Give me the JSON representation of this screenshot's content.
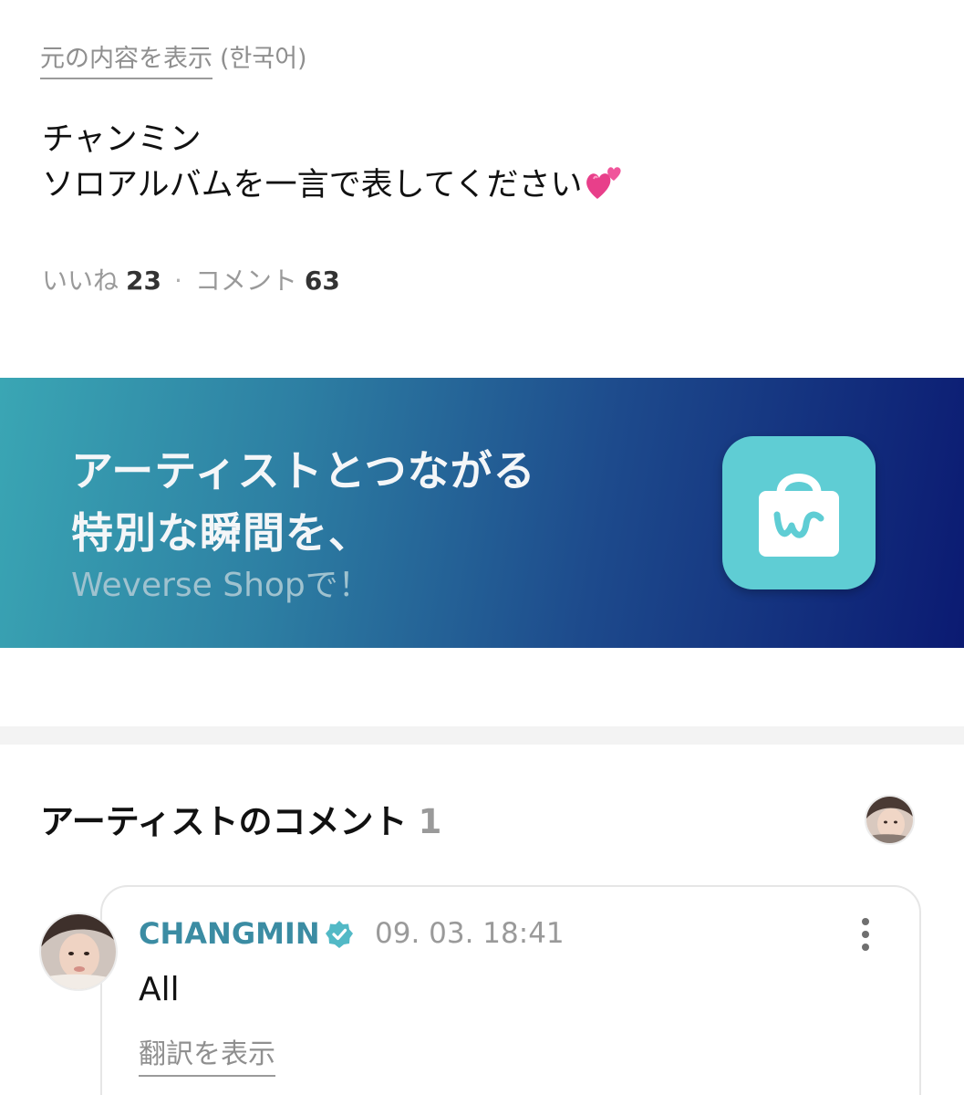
{
  "post": {
    "original_link": "元の内容を表示",
    "original_language": "(한국어)",
    "lines": [
      "チャンミン",
      "ソロアルバムを一言で表してください"
    ],
    "emoji": "two-hearts-icon",
    "likes_label": "いいね",
    "likes_count": "23",
    "separator": "·",
    "comments_label": "コメント",
    "comments_count": "63"
  },
  "banner": {
    "line1": "アーティストとつながる",
    "line2": "特別な瞬間を、",
    "subline": "Weverse Shopで！",
    "icon": "weverse-shop-bag-icon",
    "colors": {
      "start": "#3aa6b4",
      "end": "#0b1a72",
      "icon_bg": "#5fcdd4"
    }
  },
  "artist_comments": {
    "title": "アーティストのコメント",
    "count": "1",
    "items": [
      {
        "author": "CHANGMIN",
        "verified": true,
        "time": "09. 03. 18:41",
        "text": "All",
        "translate_label": "翻訳を表示"
      }
    ]
  },
  "colors": {
    "author": "#3b8ca3",
    "verified_badge": "#52b9c6",
    "muted_text": "#9a9a9a"
  }
}
